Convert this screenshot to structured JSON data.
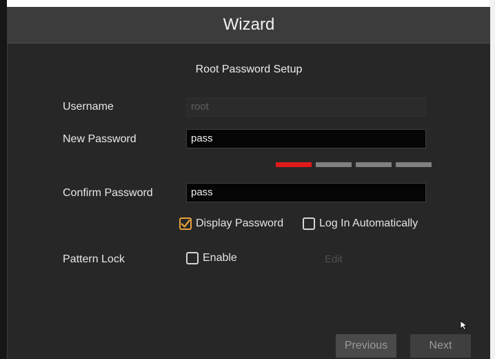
{
  "window": {
    "title": "Wizard"
  },
  "section": {
    "title": "Root Password Setup"
  },
  "form": {
    "username": {
      "label": "Username",
      "value": "root",
      "disabled": true
    },
    "new_password": {
      "label": "New Password",
      "value": "pass"
    },
    "password_strength": {
      "level": 1,
      "max": 4,
      "active_color": "#e01a1a",
      "inactive_color": "#808080"
    },
    "confirm_password": {
      "label": "Confirm Password",
      "value": "pass"
    },
    "display_password": {
      "label": "Display Password",
      "checked": true
    },
    "log_in_automatically": {
      "label": "Log In Automatically",
      "checked": false
    },
    "pattern_lock": {
      "label": "Pattern Lock",
      "enable_label": "Enable",
      "enabled": false,
      "edit_label": "Edit"
    }
  },
  "buttons": {
    "previous": "Previous",
    "next": "Next"
  },
  "colors": {
    "accent": "#e8a23a",
    "titlebar": "#3c3c3c",
    "dialog": "#272727"
  }
}
